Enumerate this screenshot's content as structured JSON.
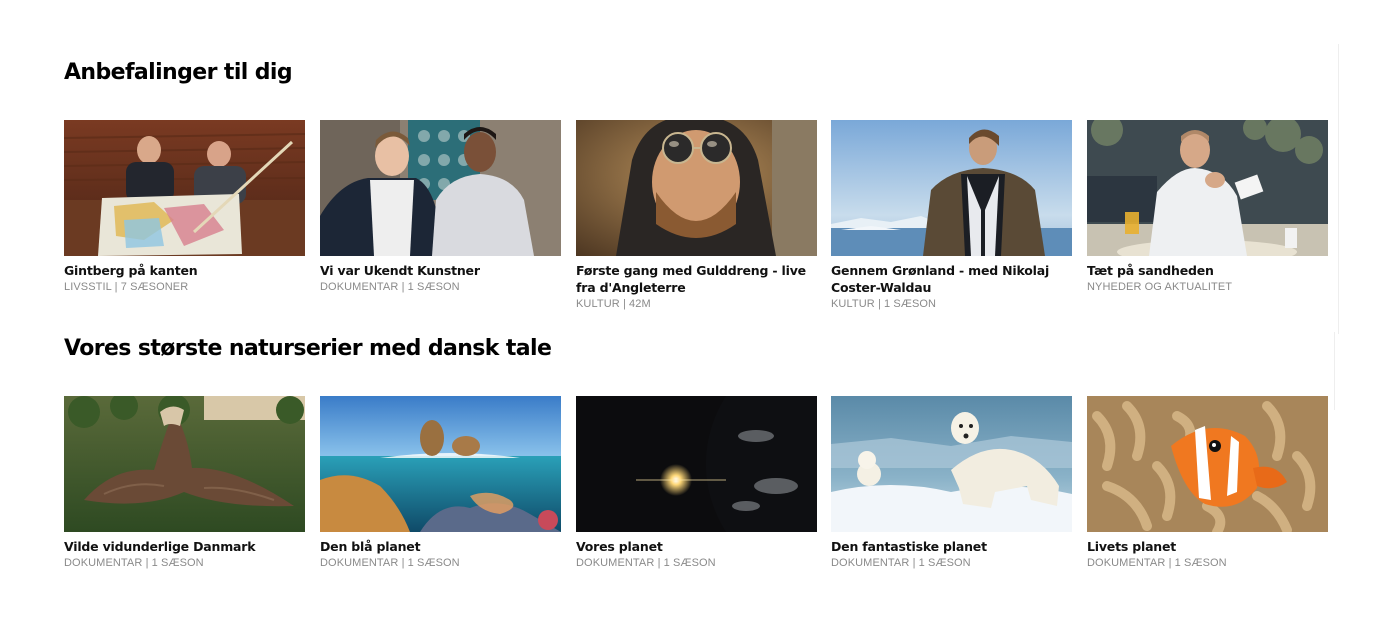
{
  "sections": [
    {
      "title": "Anbefalinger til dig",
      "cards": [
        {
          "title": "Gintberg på kanten",
          "meta": "LIVSSTIL | 7 SÆSONER"
        },
        {
          "title": "Vi var Ukendt Kunstner",
          "meta": "DOKUMENTAR | 1 SÆSON"
        },
        {
          "title": "Første gang med Gulddreng - live fra d'Angleterre",
          "meta": "KULTUR | 42M"
        },
        {
          "title": "Gennem Grønland - med Nikolaj Coster-Waldau",
          "meta": "KULTUR | 1 SÆSON"
        },
        {
          "title": "Tæt på sandheden",
          "meta": "NYHEDER OG AKTUALITET"
        }
      ]
    },
    {
      "title": "Vores største naturserier med dansk tale",
      "cards": [
        {
          "title": "Vilde vidunderlige Danmark",
          "meta": "DOKUMENTAR | 1 SÆSON"
        },
        {
          "title": "Den blå planet",
          "meta": "DOKUMENTAR | 1 SÆSON"
        },
        {
          "title": "Vores planet",
          "meta": "DOKUMENTAR | 1 SÆSON"
        },
        {
          "title": "Den fantastiske planet",
          "meta": "DOKUMENTAR | 1 SÆSON"
        },
        {
          "title": "Livets planet",
          "meta": "DOKUMENTAR | 1 SÆSON"
        }
      ]
    }
  ]
}
